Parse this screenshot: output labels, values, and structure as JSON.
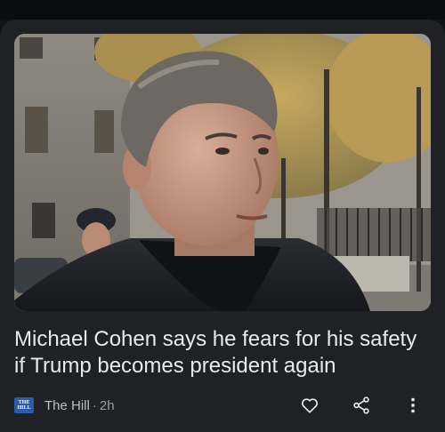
{
  "article": {
    "headline": "Michael Cohen says he fears for his safety if Trump becomes president again",
    "source": "The Hill",
    "source_logo_lines": [
      "THE",
      "HILL"
    ],
    "separator": "·",
    "age": "2h"
  },
  "icons": {
    "like": "heart-outline-icon",
    "share": "share-icon",
    "more": "more-vert-icon"
  },
  "colors": {
    "card_background": "#202124",
    "page_background": "#111214",
    "source_logo": "#2b5cab",
    "text_primary": "#e8eaed",
    "text_secondary": "#9aa0a6"
  }
}
